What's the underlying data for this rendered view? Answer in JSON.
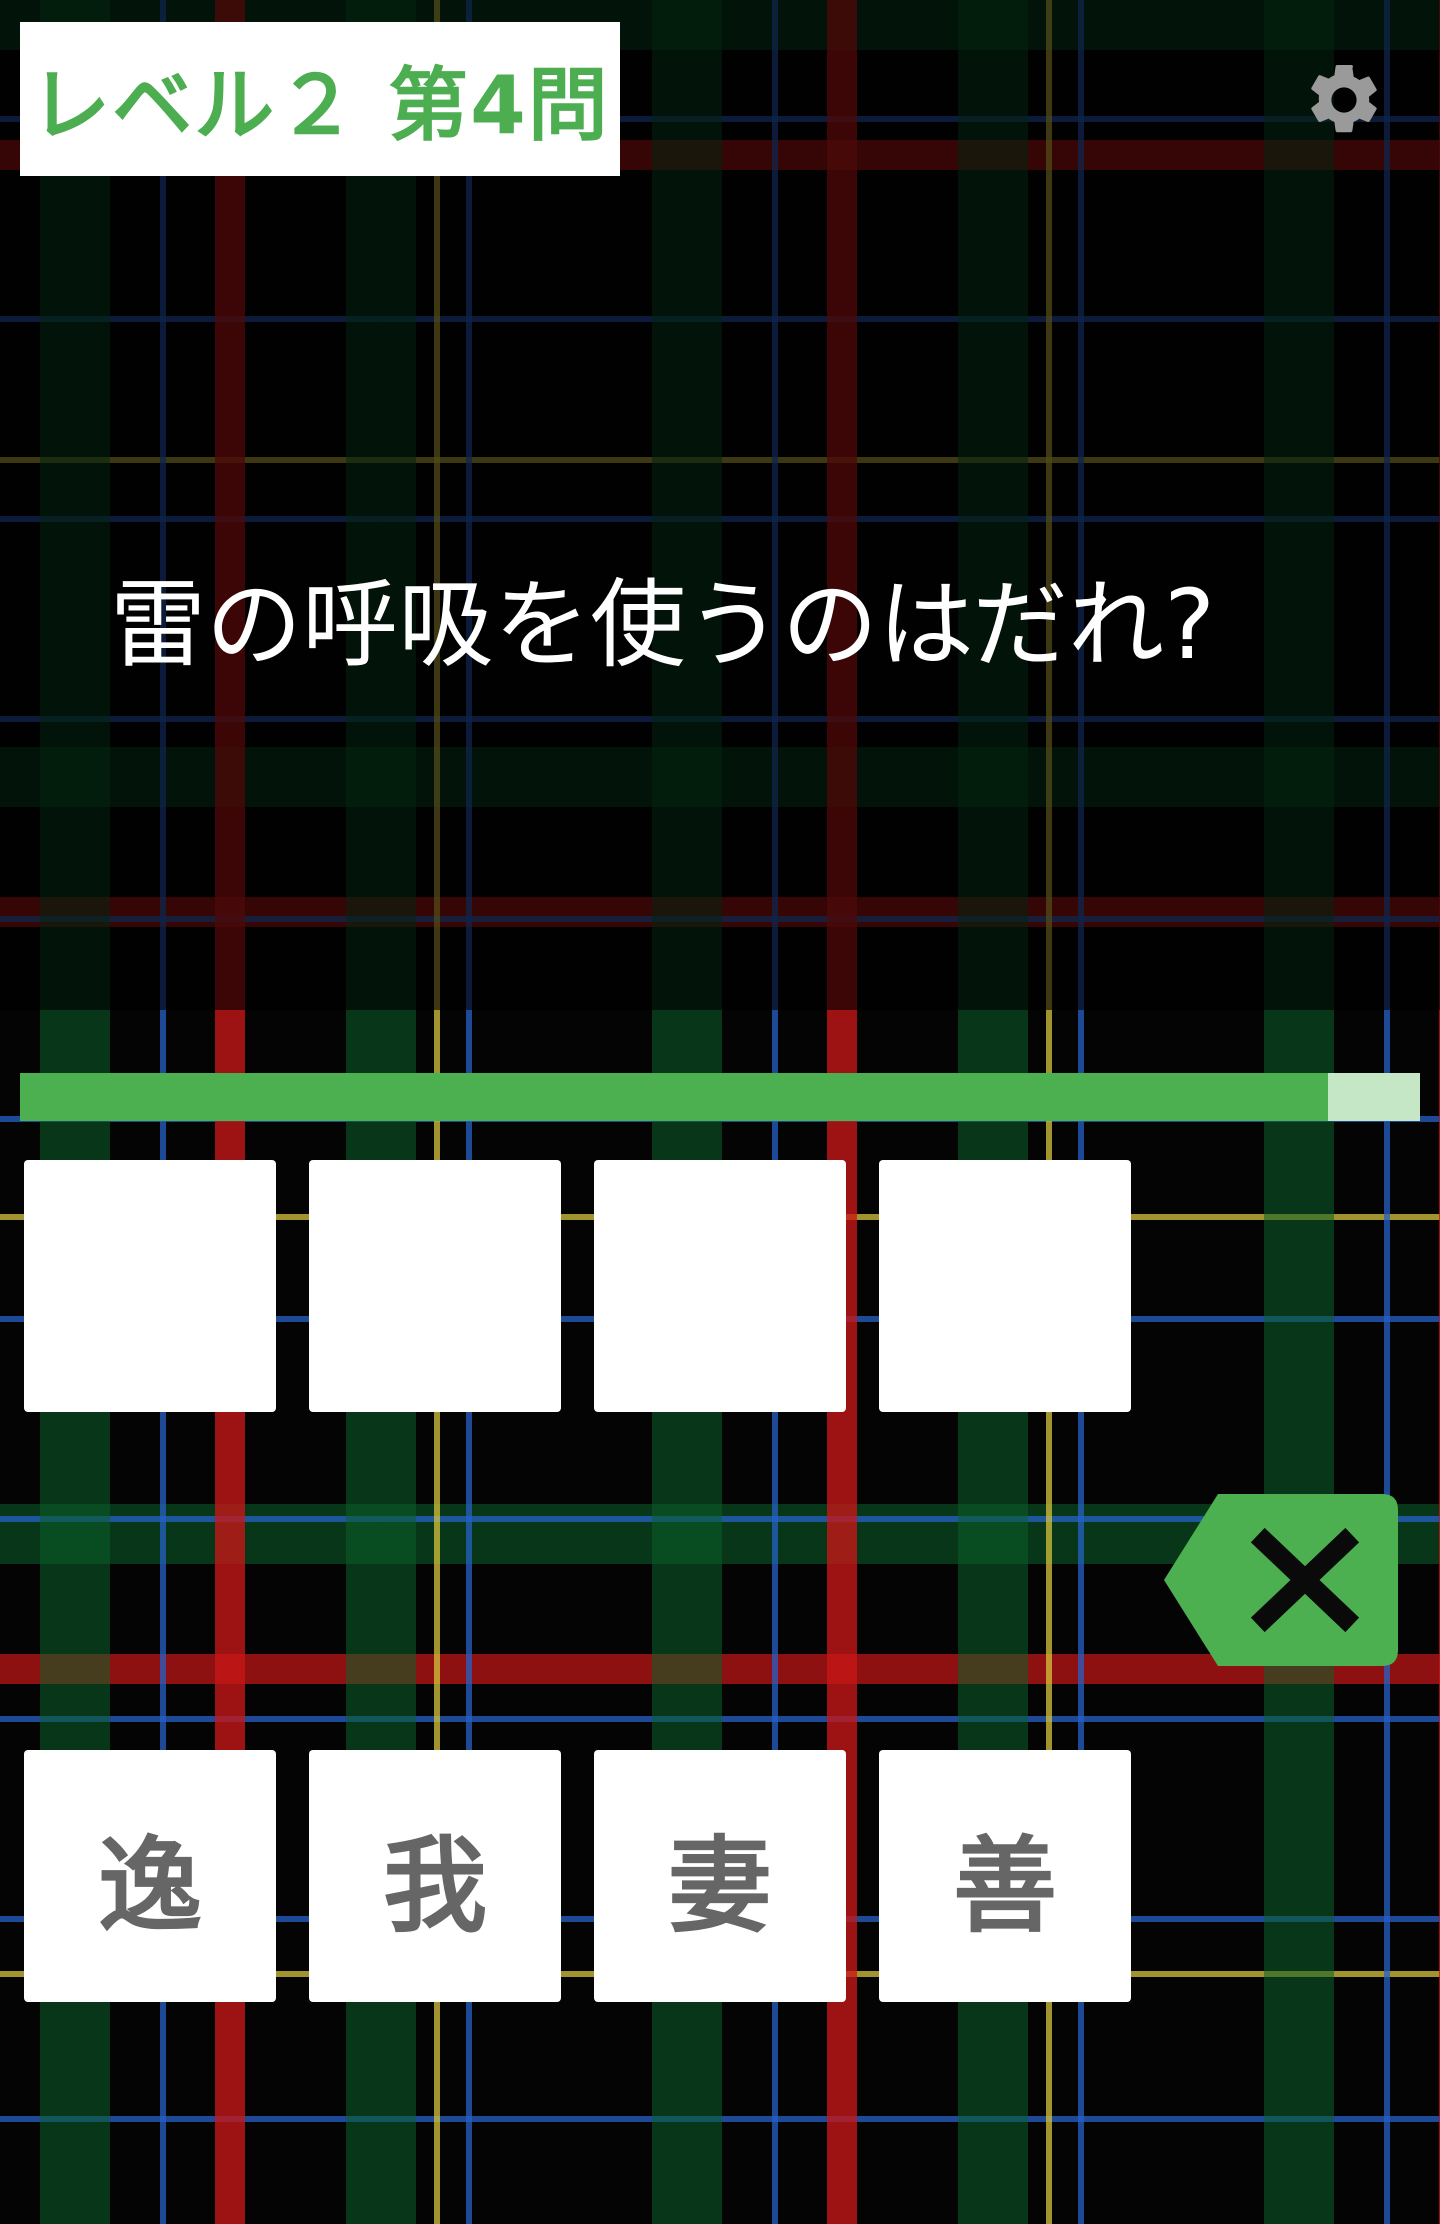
{
  "header": {
    "level_label": "レベル２ 第4問",
    "settings_icon": "gear-icon"
  },
  "question": {
    "text": "雷の呼吸を使うのはだれ?"
  },
  "timer": {
    "remaining_fraction": 0.934,
    "fill_color": "#4cb050",
    "track_color": "#c6e7c6"
  },
  "answer_slots": [
    "",
    "",
    "",
    ""
  ],
  "choices": [
    "逸",
    "我",
    "妻",
    "善"
  ],
  "delete_button": {
    "icon": "backspace-icon",
    "color": "#4cb050"
  },
  "colors": {
    "accent": "#4cae50",
    "tile_text": "#666666"
  }
}
